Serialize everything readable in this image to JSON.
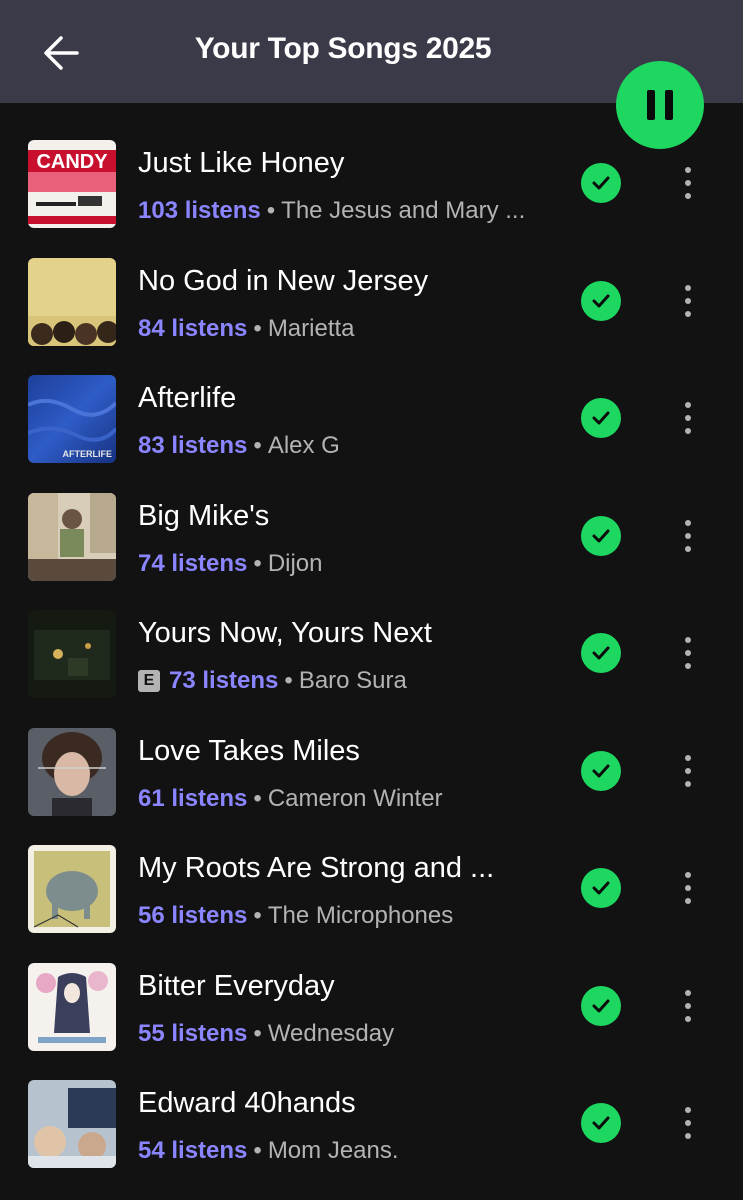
{
  "header": {
    "title": "Your Top Songs 2025",
    "back_icon": "arrow-left-icon",
    "play_state": "pause-icon"
  },
  "colors": {
    "header_bg": "#3a3a48",
    "background": "#121212",
    "accent_green": "#1ed760",
    "listens_purple": "#8b86ff",
    "secondary_text": "#b3b3b3"
  },
  "songs": [
    {
      "title": "Just Like Honey",
      "explicit": false,
      "listens": "103 listens",
      "artist": "The Jesus and Mary ...",
      "cover_text": "CANDY"
    },
    {
      "title": "No God in New Jersey",
      "explicit": false,
      "listens": "84 listens",
      "artist": "Marietta",
      "cover_text": ""
    },
    {
      "title": "Afterlife",
      "explicit": false,
      "listens": "83 listens",
      "artist": "Alex G",
      "cover_text": "AFTERLIFE"
    },
    {
      "title": "Big Mike's",
      "explicit": false,
      "listens": "74 listens",
      "artist": "Dijon",
      "cover_text": ""
    },
    {
      "title": "Yours Now, Yours Next",
      "explicit": true,
      "listens": "73 listens",
      "artist": "Baro Sura",
      "cover_text": ""
    },
    {
      "title": "Love Takes Miles",
      "explicit": false,
      "listens": "61 listens",
      "artist": "Cameron Winter",
      "cover_text": ""
    },
    {
      "title": "My Roots Are Strong and ...",
      "explicit": false,
      "listens": "56 listens",
      "artist": "The Microphones",
      "cover_text": ""
    },
    {
      "title": "Bitter Everyday",
      "explicit": false,
      "listens": "55 listens",
      "artist": "Wednesday",
      "cover_text": ""
    },
    {
      "title": "Edward 40hands",
      "explicit": false,
      "listens": "54 listens",
      "artist": "Mom Jeans.",
      "cover_text": ""
    }
  ],
  "labels": {
    "separator": "•",
    "explicit_badge": "E"
  }
}
